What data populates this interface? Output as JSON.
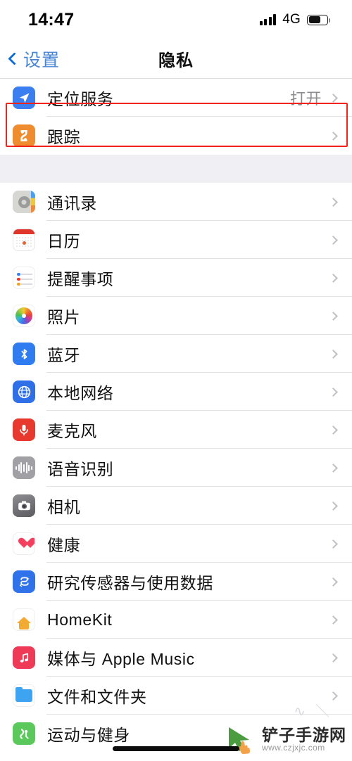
{
  "status_bar": {
    "time": "14:47",
    "network_label": "4G",
    "signal_icon": "signal-bars-icon",
    "battery_icon": "battery-icon",
    "battery_level_pct": 60
  },
  "nav_bar": {
    "back_label": "设置",
    "back_icon": "chevron-left-icon",
    "title": "隐私",
    "accent_color": "#4a86d6"
  },
  "groups": [
    {
      "name": "location-group",
      "rows": [
        {
          "label": "定位服务",
          "value": "打开",
          "icon": "location-arrow-icon",
          "icon_class": "ic-location",
          "glyph": "➤"
        },
        {
          "label": "跟踪",
          "value": "",
          "icon": "tracking-icon",
          "icon_class": "ic-tracking",
          "glyph": "ᓬ"
        }
      ]
    },
    {
      "name": "permissions-group",
      "rows": [
        {
          "label": "通讯录",
          "value": "",
          "icon": "contacts-icon",
          "icon_class": "ic-contacts",
          "glyph": ""
        },
        {
          "label": "日历",
          "value": "",
          "icon": "calendar-icon",
          "icon_class": "ic-calendar",
          "glyph": ""
        },
        {
          "label": "提醒事项",
          "value": "",
          "icon": "reminders-icon",
          "icon_class": "ic-reminders",
          "glyph": ""
        },
        {
          "label": "照片",
          "value": "",
          "icon": "photos-icon",
          "icon_class": "ic-photos",
          "glyph": ""
        },
        {
          "label": "蓝牙",
          "value": "",
          "icon": "bluetooth-icon",
          "icon_class": "ic-bluetooth",
          "glyph": ""
        },
        {
          "label": "本地网络",
          "value": "",
          "icon": "globe-icon",
          "icon_class": "ic-network",
          "glyph": ""
        },
        {
          "label": "麦克风",
          "value": "",
          "icon": "microphone-icon",
          "icon_class": "ic-mic",
          "glyph": ""
        },
        {
          "label": "语音识别",
          "value": "",
          "icon": "speech-waveform-icon",
          "icon_class": "ic-speech",
          "glyph": ""
        },
        {
          "label": "相机",
          "value": "",
          "icon": "camera-icon",
          "icon_class": "ic-camera",
          "glyph": ""
        },
        {
          "label": "健康",
          "value": "",
          "icon": "heart-icon",
          "icon_class": "ic-health",
          "glyph": ""
        },
        {
          "label": "研究传感器与使用数据",
          "value": "",
          "icon": "research-sensor-icon",
          "icon_class": "ic-research",
          "glyph": ""
        },
        {
          "label": "HomeKit",
          "value": "",
          "icon": "house-icon",
          "icon_class": "ic-homekit",
          "glyph": ""
        },
        {
          "label": "媒体与 Apple Music",
          "value": "",
          "icon": "music-note-icon",
          "icon_class": "ic-music",
          "glyph": ""
        },
        {
          "label": "文件和文件夹",
          "value": "",
          "icon": "folder-icon",
          "icon_class": "ic-files",
          "glyph": ""
        },
        {
          "label": "运动与健身",
          "value": "",
          "icon": "fitness-icon",
          "icon_class": "ic-fitness",
          "glyph": ""
        }
      ]
    }
  ],
  "annotation": {
    "name": "red-highlight-box",
    "targets_row": "定位服务",
    "color": "#f2231b"
  },
  "watermark": {
    "title": "铲子手游网",
    "url": "www.czjxjc.com",
    "logo_icon": "green-cursor-logo",
    "logo_color": "#4a9c3f"
  },
  "home_indicator": {
    "name": "home-indicator"
  }
}
